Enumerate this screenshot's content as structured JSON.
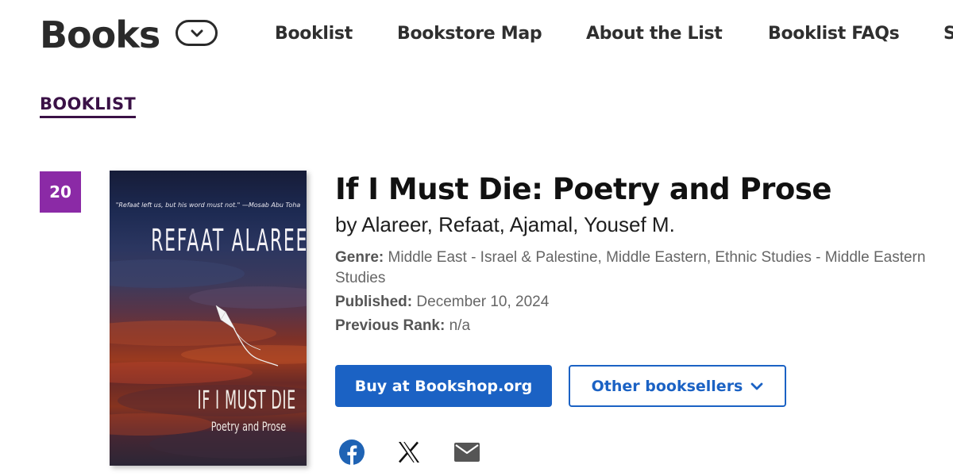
{
  "header": {
    "logo": "Books",
    "nav": [
      {
        "label": "Booklist"
      },
      {
        "label": "Bookstore Map"
      },
      {
        "label": "About the List"
      },
      {
        "label": "Booklist FAQs"
      },
      {
        "label": "S"
      }
    ]
  },
  "breadcrumb": "BOOKLIST",
  "book": {
    "rank": "20",
    "title": "If I Must Die: Poetry and Prose",
    "authors": "by Alareer, Refaat, Ajamal, Yousef M.",
    "genre_label": "Genre:",
    "genre_value": "Middle East - Israel & Palestine, Middle Eastern, Ethnic Studies - Middle Eastern Studies",
    "published_label": "Published:",
    "published_value": "December 10, 2024",
    "prev_rank_label": "Previous Rank:",
    "prev_rank_value": "n/a",
    "cover": {
      "quote": "\"Refaat left us, but his word must not.\" —Mosab Abu Toha",
      "author": "REFAAT ALAREER",
      "title": "IF I MUST DIE",
      "subtitle": "Poetry and Prose"
    }
  },
  "buttons": {
    "buy": "Buy at Bookshop.org",
    "other": "Other booksellers"
  },
  "share": {
    "icons": [
      "facebook-icon",
      "x-icon",
      "email-icon"
    ]
  },
  "colors": {
    "rank_badge": "#8b2aa6",
    "primary": "#1b62c4",
    "breadcrumb": "#3a1146",
    "facebook": "#1f63b4"
  }
}
